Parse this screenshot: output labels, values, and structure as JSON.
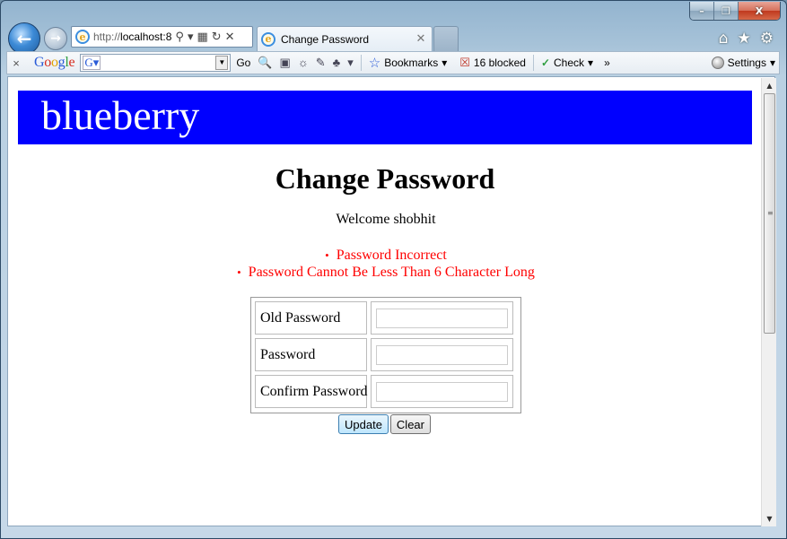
{
  "window": {
    "minimize_label": "–",
    "restore_label": "❐",
    "close_label": "X"
  },
  "nav": {
    "back_icon": "back-arrow-icon",
    "forward_icon": "forward-arrow-icon",
    "address_prefix": "http://",
    "address_host": "localhost:8",
    "tab_title": "Change Password",
    "tab_close": "✕"
  },
  "toolbar": {
    "close_label": "×",
    "google": "Google",
    "search_value": "",
    "go_label": "Go",
    "bookmarks_label": "Bookmarks",
    "blocked_label": "16 blocked",
    "check_label": "Check",
    "more_label": "»",
    "settings_label": "Settings"
  },
  "page": {
    "brand": "blueberry",
    "brand_bg": "#0000ff",
    "heading": "Change Password",
    "welcome": "Welcome shobhit",
    "errors": [
      "Password Incorrect",
      "Password Cannot Be Less Than 6 Character Long"
    ],
    "error_color": "#ff0000",
    "form": {
      "old_password_label": "Old Password",
      "old_password_value": "",
      "password_label": "Password",
      "password_value": "",
      "confirm_password_label": "Confirm Password",
      "confirm_password_value": ""
    },
    "update_label": "Update",
    "clear_label": "Clear"
  }
}
